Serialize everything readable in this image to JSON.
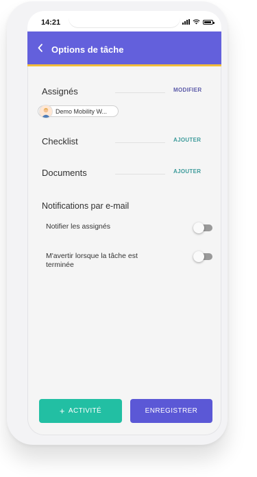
{
  "status_bar": {
    "time": "14:21"
  },
  "header": {
    "title": "Options de tâche"
  },
  "sections": {
    "assignees": {
      "title": "Assignés",
      "action": "MODIFIER"
    },
    "assignee_chip": {
      "label": "Demo Mobility W..."
    },
    "checklist": {
      "title": "Checklist",
      "action": "AJOUTER"
    },
    "documents": {
      "title": "Documents",
      "action": "AJOUTER"
    }
  },
  "notifications": {
    "title": "Notifications par e-mail",
    "items": [
      {
        "label": "Notifier les assignés",
        "enabled": false
      },
      {
        "label": "M'avertir lorsque la tâche est terminée",
        "enabled": false
      }
    ]
  },
  "footer": {
    "activity_label": "ACTIVITÉ",
    "save_label": "ENREGISTRER"
  },
  "colors": {
    "header": "#6360dc",
    "header_border": "#f2bd3b",
    "activity_button": "#22bfa3",
    "save_button": "#5b58d6",
    "ajouter_link": "#3b9a9a",
    "modifier_link": "#5a59a8"
  }
}
